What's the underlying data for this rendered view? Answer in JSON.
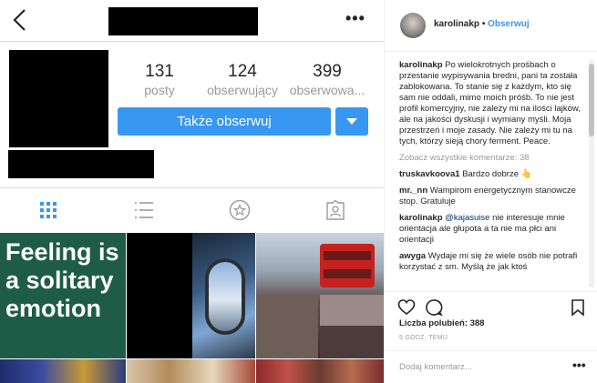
{
  "profile": {
    "stats": [
      {
        "num": "131",
        "label": "posty"
      },
      {
        "num": "124",
        "label": "obserwujący"
      },
      {
        "num": "399",
        "label": "obserwowa..."
      }
    ],
    "follow_label": "Także obserwuj"
  },
  "grid": {
    "quote_text": "Feeling is a solitary emotion"
  },
  "post": {
    "username": "karolinakp",
    "separator": "•",
    "follow_label": "Obserwuj",
    "caption_user": "karolinakp",
    "caption": "Po wielokrotnych prośbach o przestanie wypisywania bredni, pani ta została zablokowana. To stanie się z każdym, kto się sam nie oddali, mimo moich próśb. To nie jest profil komercyjny, nie zależy mi na ilości lajków, ale na jakości dyskusji i wymiany myśli. Moja przestrzeń i moje zasady. Nie zależy mi tu na tych, którzy sieją chory ferment. Peace.",
    "view_all": "Zobacz wszystkie komentarze: 38",
    "comments": [
      {
        "user": "truskavkoova1",
        "text": "Bardzo dobrze 👆"
      },
      {
        "user": "mr._nn",
        "text": "Wampirom energetycznym stanowcze stop. Gratuluje"
      },
      {
        "user": "karolinakp",
        "mention": "@kajasuise",
        "text": "nie interesuje mnie orientacja ale głupota a ta nie ma płci ani orientacji"
      },
      {
        "user": "awyga",
        "text": "Wydaje mi się że wiele osób nie potrafi korzystać z sm. Myślą że jak ktoś"
      }
    ],
    "likes": "Liczba polubień: 388",
    "time": "5 GODZ. TEMU",
    "add_comment_placeholder": "Dodaj komentarz...",
    "more": "•••"
  },
  "topbar": {
    "more": "•••"
  }
}
